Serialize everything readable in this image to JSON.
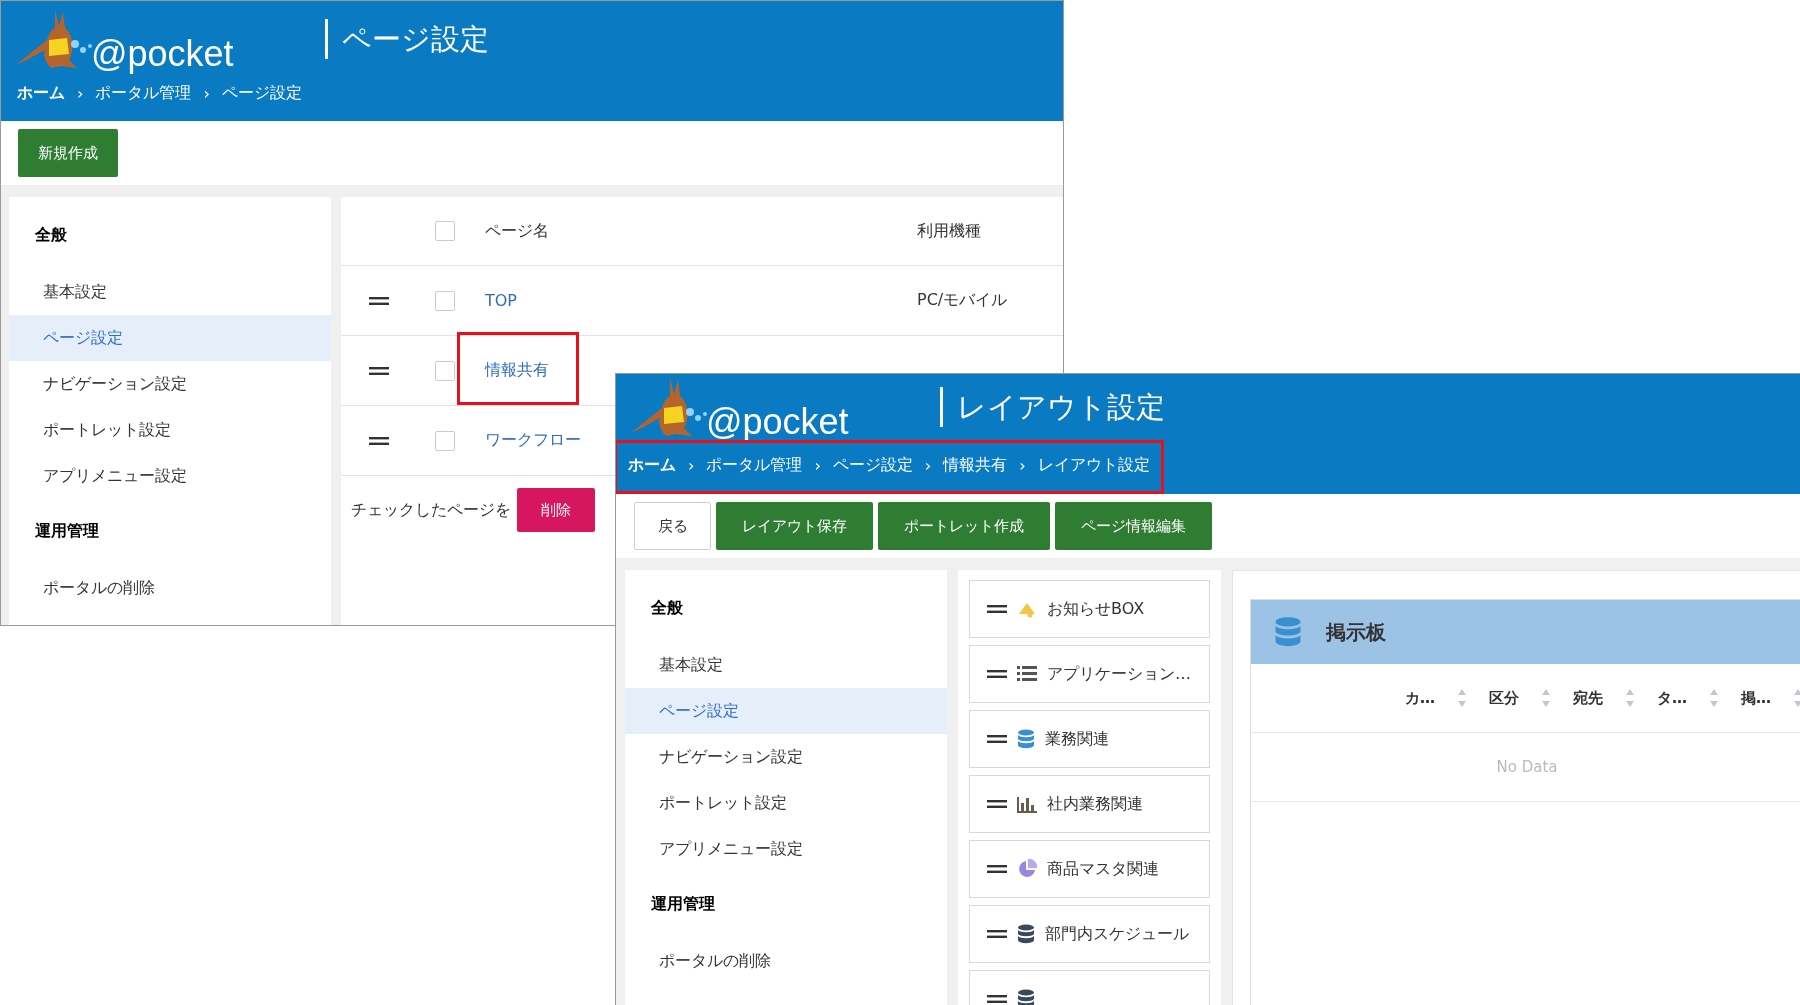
{
  "page_settings_window": {
    "logo": "@pocket",
    "title": "ページ設定",
    "breadcrumb": [
      {
        "label": "ホーム"
      },
      {
        "separator": "›",
        "label": "ポータル管理"
      },
      {
        "separator": "›",
        "label": "ページ設定"
      }
    ],
    "new_button": "新規作成",
    "sidebar": [
      {
        "heading": "全般",
        "items": [
          {
            "label": "基本設定",
            "selected": false
          },
          {
            "label": "ページ設定",
            "selected": true
          },
          {
            "label": "ナビゲーション設定",
            "selected": false
          },
          {
            "label": "ポートレット設定",
            "selected": false
          },
          {
            "label": "アプリメニュー設定",
            "selected": false
          }
        ]
      },
      {
        "heading": "運用管理",
        "items": [
          {
            "label": "ポータルの削除",
            "selected": false
          }
        ]
      }
    ],
    "table": {
      "header_checked": false,
      "columns": [
        "ページ名",
        "利用機種"
      ],
      "rows": [
        {
          "name": "TOP",
          "device": "PC/モバイル",
          "checked": false,
          "highlighted": false
        },
        {
          "name": "情報共有",
          "checked": false,
          "highlighted": true
        },
        {
          "name": "ワークフロー",
          "checked": false,
          "highlighted": false
        }
      ]
    },
    "footer": {
      "label": "チェックしたページを",
      "delete_button": "削除"
    }
  },
  "layout_settings_window": {
    "logo": "@pocket",
    "title": "レイアウト設定",
    "breadcrumb": [
      {
        "label": "ホーム"
      },
      {
        "separator": "›",
        "label": "ポータル管理"
      },
      {
        "separator": "›",
        "label": "ページ設定"
      },
      {
        "separator": "›",
        "label": "情報共有"
      },
      {
        "separator": "›",
        "label": "レイアウト設定"
      }
    ],
    "breadcrumb_highlighted": true,
    "buttons": [
      {
        "label": "戻る",
        "kind": "plain"
      },
      {
        "label": "レイアウト保存",
        "kind": "primary"
      },
      {
        "label": "ポートレット作成",
        "kind": "primary"
      },
      {
        "label": "ページ情報編集",
        "kind": "primary"
      }
    ],
    "sidebar": [
      {
        "heading": "全般",
        "items": [
          {
            "label": "基本設定",
            "selected": false
          },
          {
            "label": "ページ設定",
            "selected": true
          },
          {
            "label": "ナビゲーション設定",
            "selected": false
          },
          {
            "label": "ポートレット設定",
            "selected": false
          },
          {
            "label": "アプリメニュー設定",
            "selected": false
          }
        ]
      },
      {
        "heading": "運用管理",
        "items": [
          {
            "label": "ポータルの削除",
            "selected": false
          }
        ]
      }
    ],
    "portlets": [
      {
        "label": "お知らせBOX",
        "kind": "bell"
      },
      {
        "label": "アプリケーション…",
        "kind": "list"
      },
      {
        "label": "業務関連",
        "kind": "database"
      },
      {
        "label": "社内業務関連",
        "kind": "bars"
      },
      {
        "label": "商品マスタ関連",
        "kind": "pie"
      },
      {
        "label": "部門内スケジュール",
        "kind": "database-dark"
      },
      {
        "kind": "database-dark"
      }
    ],
    "board": {
      "title": "掲示板",
      "columns": [
        "カ…",
        "区分",
        "宛先",
        "タ…",
        "掲…"
      ],
      "empty_text": "No Data"
    }
  }
}
